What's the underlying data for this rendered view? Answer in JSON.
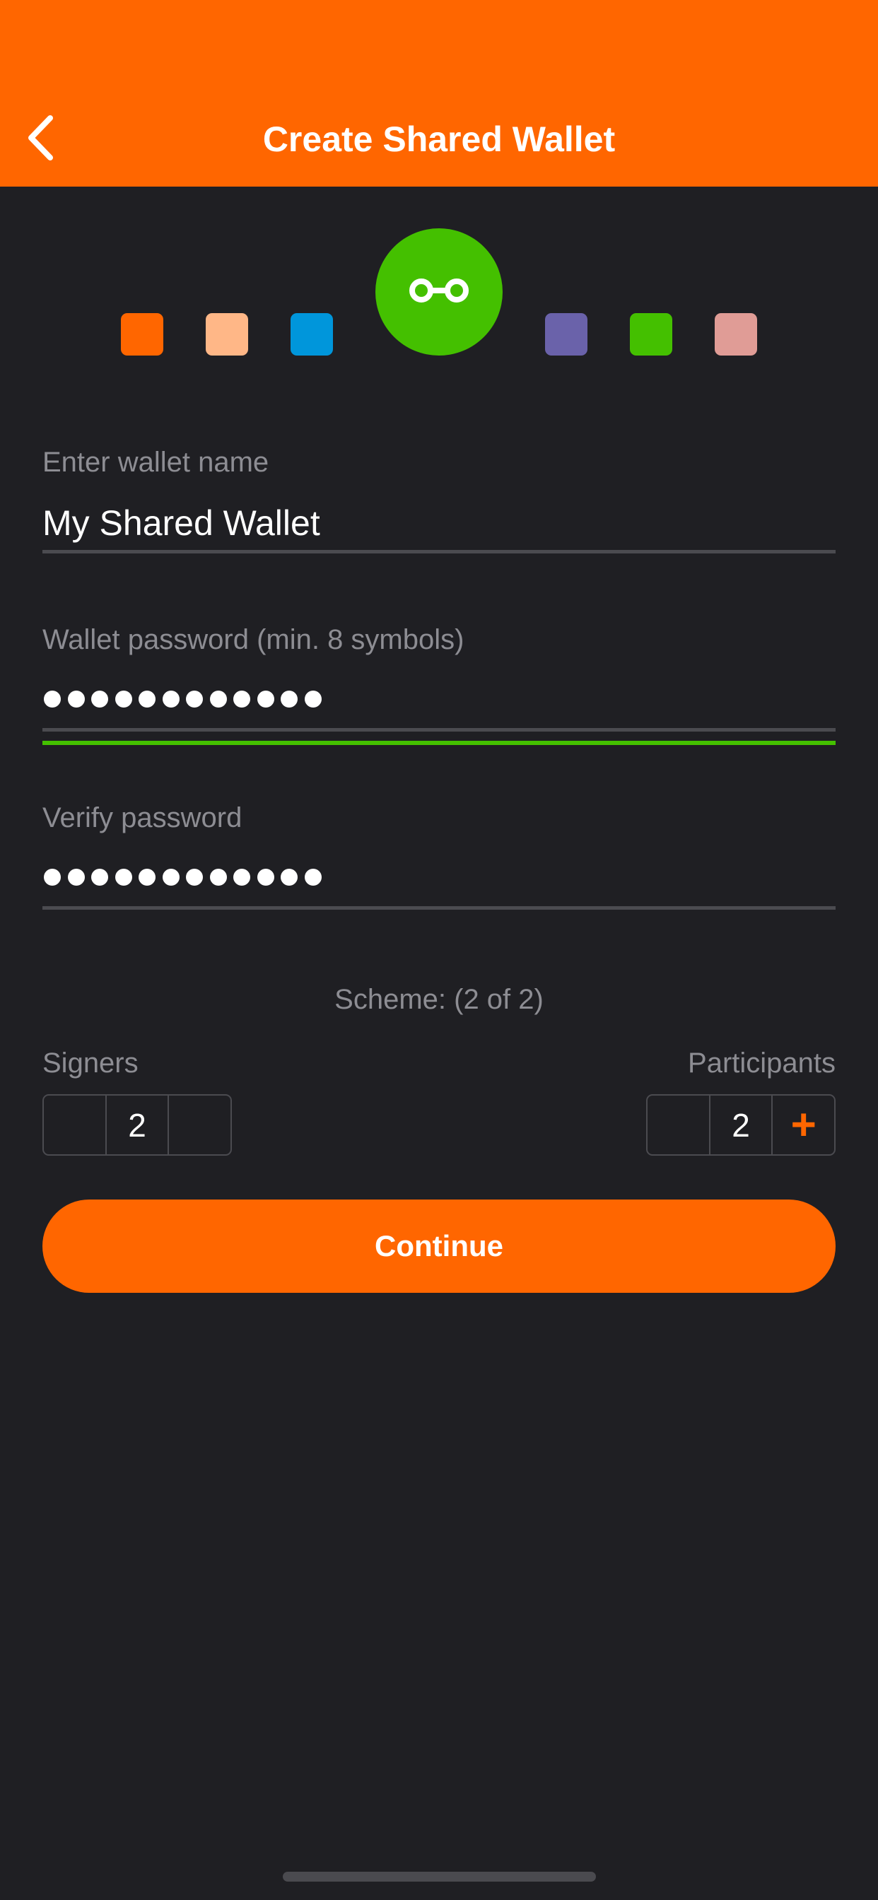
{
  "header": {
    "title": "Create Shared Wallet",
    "background_color": "#ff6600",
    "back_icon": "chevron-left-icon"
  },
  "avatar": {
    "icon": "multisig-link-icon",
    "color": "#44c000"
  },
  "color_picker": {
    "swatches": [
      "#ff6600",
      "#ffb787",
      "#0096db",
      "#6a62aa",
      "#44c000",
      "#e09c96"
    ],
    "selected_color": "#44c000"
  },
  "wallet_name": {
    "label": "Enter wallet name",
    "value": "My Shared Wallet"
  },
  "password": {
    "label": "Wallet password (min. 8 symbols)",
    "masked_length": 12,
    "strength_color": "#44c000"
  },
  "verify_password": {
    "label": "Verify password",
    "masked_length": 12
  },
  "scheme": {
    "label": "Scheme: (2 of 2)"
  },
  "signers": {
    "label": "Signers",
    "value": "2"
  },
  "participants": {
    "label": "Participants",
    "value": "2",
    "increment_icon": "plus-icon"
  },
  "continue_button": {
    "label": "Continue"
  },
  "theme": {
    "background": "#1f1f23",
    "accent": "#ff6600",
    "muted_text": "#8d8d93",
    "divider": "#4b4b50"
  }
}
